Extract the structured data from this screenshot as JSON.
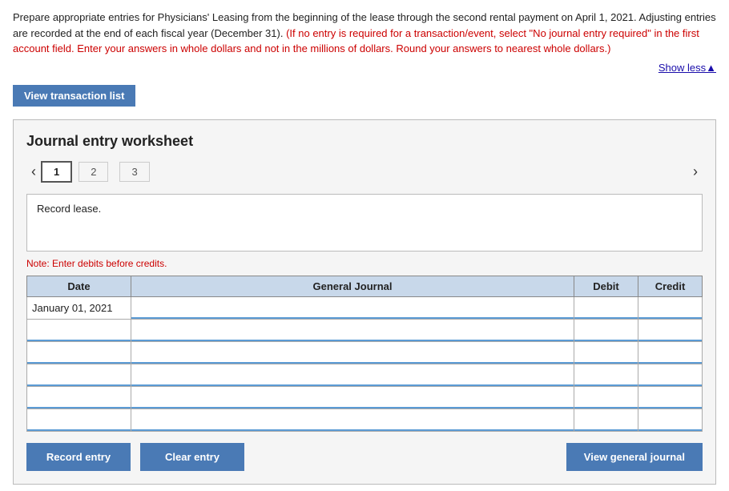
{
  "instructions": {
    "main_text": "Prepare appropriate entries for Physicians' Leasing from the beginning of the lease through the second rental payment on April 1, 2021. Adjusting entries are recorded at the end of each fiscal year (December 31). ",
    "red_text": "(If no entry is required for a transaction/event, select \"No journal entry required\" in the first account field. Enter your answers in whole dollars and not in the millions of dollars. Round your answers to nearest whole dollars.)",
    "show_less_label": "Show less▲"
  },
  "view_transaction_btn": "View transaction list",
  "worksheet": {
    "title": "Journal entry worksheet",
    "tabs": [
      {
        "label": "1",
        "active": true
      },
      {
        "label": "2",
        "active": false
      },
      {
        "label": "3",
        "active": false
      }
    ],
    "description": "Record lease.",
    "note": "Note: Enter debits before credits.",
    "table": {
      "headers": [
        "Date",
        "General Journal",
        "Debit",
        "Credit"
      ],
      "rows": [
        {
          "date": "January 01, 2021",
          "general_journal": "",
          "debit": "",
          "credit": ""
        },
        {
          "date": "",
          "general_journal": "",
          "debit": "",
          "credit": ""
        },
        {
          "date": "",
          "general_journal": "",
          "debit": "",
          "credit": ""
        },
        {
          "date": "",
          "general_journal": "",
          "debit": "",
          "credit": ""
        },
        {
          "date": "",
          "general_journal": "",
          "debit": "",
          "credit": ""
        },
        {
          "date": "",
          "general_journal": "",
          "debit": "",
          "credit": ""
        }
      ]
    }
  },
  "buttons": {
    "record_entry": "Record entry",
    "clear_entry": "Clear entry",
    "view_general_journal": "View general journal"
  }
}
